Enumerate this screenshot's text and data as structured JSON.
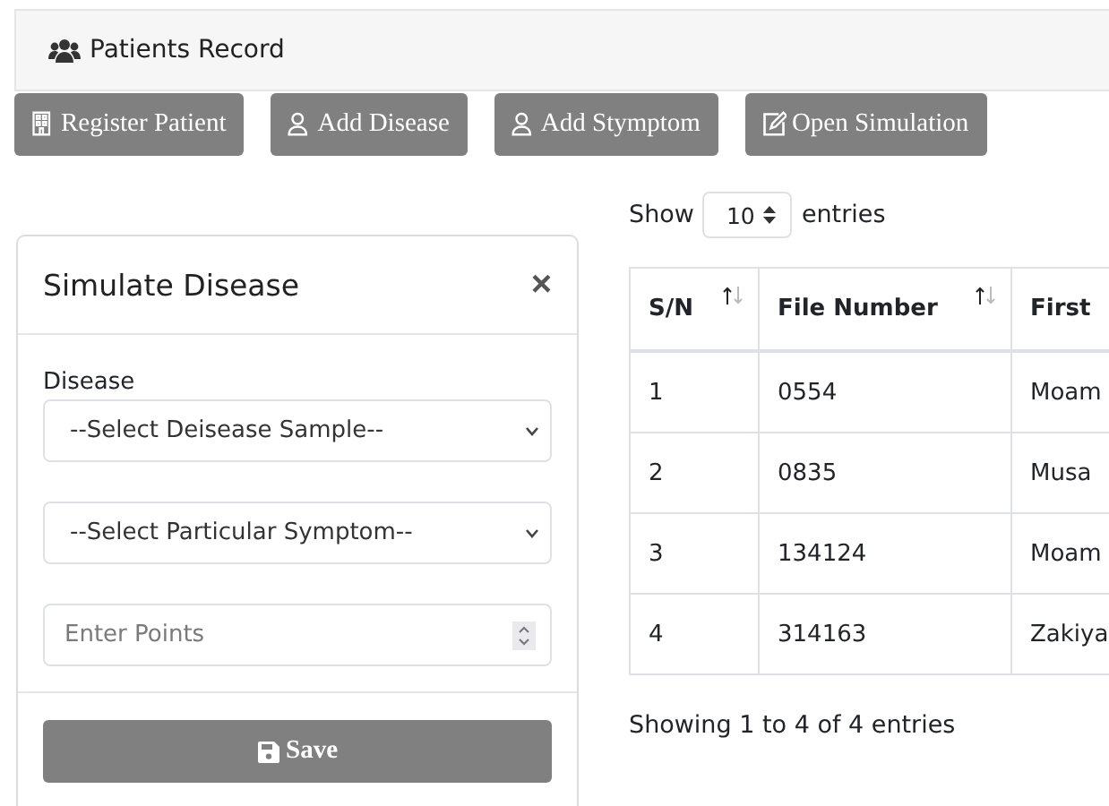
{
  "header": {
    "title": "Patients Record"
  },
  "toolbar": [
    {
      "label": "Register Patient",
      "kind": "building"
    },
    {
      "label": "Add Disease",
      "kind": "user"
    },
    {
      "label": "Add Stymptom",
      "kind": "user"
    },
    {
      "label": "Open Simulation",
      "kind": "edit"
    }
  ],
  "modal": {
    "title": "Simulate Disease",
    "close": "×",
    "disease_label": "Disease",
    "fields": [
      {
        "kind": "select",
        "value": "--Select Deisease Sample--"
      },
      {
        "kind": "select",
        "value": "--Select Particular Symptom--"
      },
      {
        "kind": "number",
        "placeholder": "Enter Points"
      }
    ],
    "save": "Save"
  },
  "table_length": {
    "show": "Show",
    "value": "10",
    "entries": "entries"
  },
  "table": {
    "columns": [
      {
        "label": "S/N",
        "sortable": true
      },
      {
        "label": "File Number",
        "sortable": true
      },
      {
        "label": "First"
      }
    ],
    "rows": [
      [
        "1",
        "0554",
        "Moam"
      ],
      [
        "2",
        "0835",
        "Musa"
      ],
      [
        "3",
        "134124",
        "Moam"
      ],
      [
        "4",
        "314163",
        "Zakiya"
      ]
    ]
  },
  "info": "Showing 1 to 4 of 4 entries"
}
